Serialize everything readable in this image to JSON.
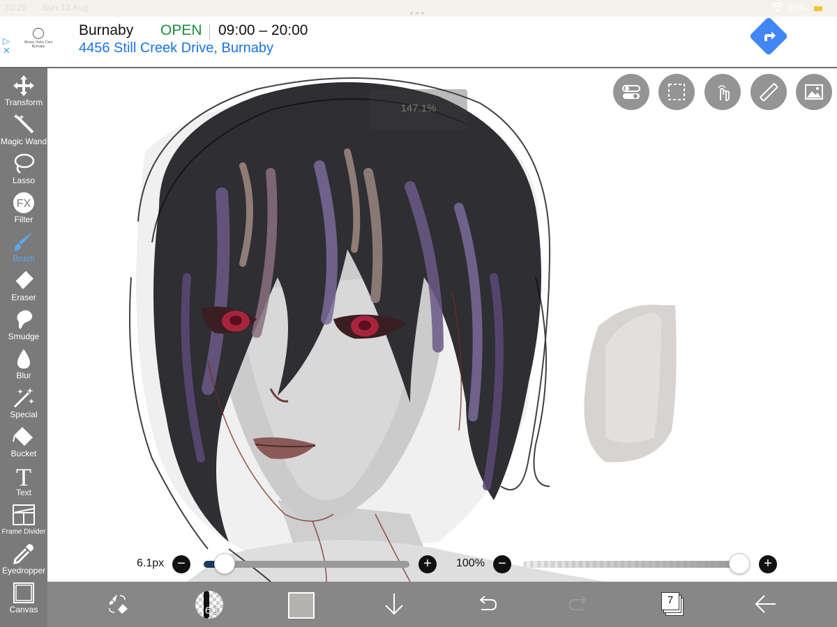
{
  "status_bar": {
    "time": "20:29",
    "date": "Sun 13 Aug",
    "battery": "65%"
  },
  "ad": {
    "logo_text": "Money Volvo Cars Burnaby",
    "business": "Burnaby",
    "status": "OPEN",
    "hours": "09:00 – 20:00",
    "address": "4456 Still Creek Drive, Burnaby",
    "directions_icon": "directions-icon",
    "adchoices_icon": "adchoices-icon",
    "close_icon": "close-icon"
  },
  "tools": [
    {
      "label": "Transform",
      "icon": "move-arrows-icon"
    },
    {
      "label": "Magic Wand",
      "icon": "magic-wand-icon"
    },
    {
      "label": "Lasso",
      "icon": "lasso-icon"
    },
    {
      "label": "Filter",
      "icon": "fx-icon"
    },
    {
      "label": "Brush",
      "icon": "brush-icon",
      "active": true
    },
    {
      "label": "Eraser",
      "icon": "eraser-icon"
    },
    {
      "label": "Smudge",
      "icon": "smudge-icon"
    },
    {
      "label": "Blur",
      "icon": "drop-icon"
    },
    {
      "label": "Special",
      "icon": "sparkle-icon"
    },
    {
      "label": "Bucket",
      "icon": "bucket-icon"
    },
    {
      "label": "Text",
      "icon": "text-icon"
    },
    {
      "label": "Frame Divider",
      "icon": "frame-divider-icon"
    },
    {
      "label": "Eyedropper",
      "icon": "eyedropper-icon"
    },
    {
      "label": "Canvas",
      "icon": "canvas-icon"
    }
  ],
  "zoom_readout": "147.1%",
  "top_right_buttons": [
    "toggle-icon",
    "selection-icon",
    "touch-gesture-icon",
    "ruler-icon",
    "image-icon"
  ],
  "brush": {
    "size_label": "6.1px",
    "size_fraction": 0.1,
    "opacity_label": "100%",
    "opacity_fraction": 1.0,
    "preview_value": "6.1"
  },
  "bottom_bar": {
    "layer_count": "7",
    "current_color": "#b5b3b2"
  },
  "colors": {
    "accent": "#5aa8f0",
    "toolbar": "#7a7a7a",
    "ad_open": "#1e8e3e",
    "ad_link": "#1a73e8"
  }
}
